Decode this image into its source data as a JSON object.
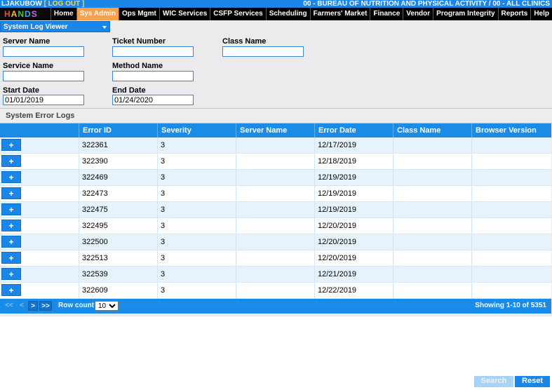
{
  "header": {
    "user": "LJAKUBOW",
    "user_suffix": "[ ",
    "user_link": "LOG OUT",
    "user_close": " ]",
    "clinic": "00 - BUREAU OF NUTRITION AND PHYSICAL ACTIVITY / 00 - ALL CLINICS"
  },
  "logo_letters": [
    "H",
    "A",
    "N",
    "D",
    "S"
  ],
  "nav": [
    "Home",
    "Sys Admin",
    "Ops Mgmt",
    "WIC Services",
    "CSFP Services",
    "Scheduling",
    "Farmers' Market",
    "Finance",
    "Vendor",
    "Program Integrity",
    "Reports",
    "Help"
  ],
  "module_select": "System Log Viewer",
  "filters": {
    "server_name": {
      "label": "Server Name",
      "value": ""
    },
    "ticket_number": {
      "label": "Ticket Number",
      "value": ""
    },
    "class_name": {
      "label": "Class Name",
      "value": ""
    },
    "service_name": {
      "label": "Service Name",
      "value": ""
    },
    "method_name": {
      "label": "Method Name",
      "value": ""
    },
    "start_date": {
      "label": "Start Date",
      "value": "01/01/2019"
    },
    "end_date": {
      "label": "End Date",
      "value": "01/24/2020"
    }
  },
  "section_title": "System Error Logs",
  "grid": {
    "columns": [
      "",
      "Error ID",
      "Severity",
      "Server Name",
      "Error Date",
      "Class Name",
      "Browser Version"
    ],
    "expand_label": "+",
    "rows": [
      {
        "error_id": "322361",
        "severity": "3",
        "server": "",
        "date": "12/17/2019",
        "class": "",
        "browser": ""
      },
      {
        "error_id": "322390",
        "severity": "3",
        "server": "",
        "date": "12/18/2019",
        "class": "",
        "browser": ""
      },
      {
        "error_id": "322469",
        "severity": "3",
        "server": "",
        "date": "12/19/2019",
        "class": "",
        "browser": ""
      },
      {
        "error_id": "322473",
        "severity": "3",
        "server": "",
        "date": "12/19/2019",
        "class": "",
        "browser": ""
      },
      {
        "error_id": "322475",
        "severity": "3",
        "server": "",
        "date": "12/19/2019",
        "class": "",
        "browser": ""
      },
      {
        "error_id": "322495",
        "severity": "3",
        "server": "",
        "date": "12/20/2019",
        "class": "",
        "browser": ""
      },
      {
        "error_id": "322500",
        "severity": "3",
        "server": "",
        "date": "12/20/2019",
        "class": "",
        "browser": ""
      },
      {
        "error_id": "322513",
        "severity": "3",
        "server": "",
        "date": "12/20/2019",
        "class": "",
        "browser": ""
      },
      {
        "error_id": "322539",
        "severity": "3",
        "server": "",
        "date": "12/21/2019",
        "class": "",
        "browser": ""
      },
      {
        "error_id": "322609",
        "severity": "3",
        "server": "",
        "date": "12/22/2019",
        "class": "",
        "browser": ""
      }
    ]
  },
  "pager": {
    "first": "<<",
    "prev": "<",
    "next": ">",
    "last": ">>",
    "row_count_label": "Row count:",
    "row_count": "10",
    "showing": "Showing 1-10 of 5351"
  },
  "buttons": {
    "search": "Search",
    "reset": "Reset"
  },
  "colors": {
    "accent": "#1a86e8",
    "active_nav": "#f7a04d",
    "row_alt": "#e6f3fc"
  }
}
